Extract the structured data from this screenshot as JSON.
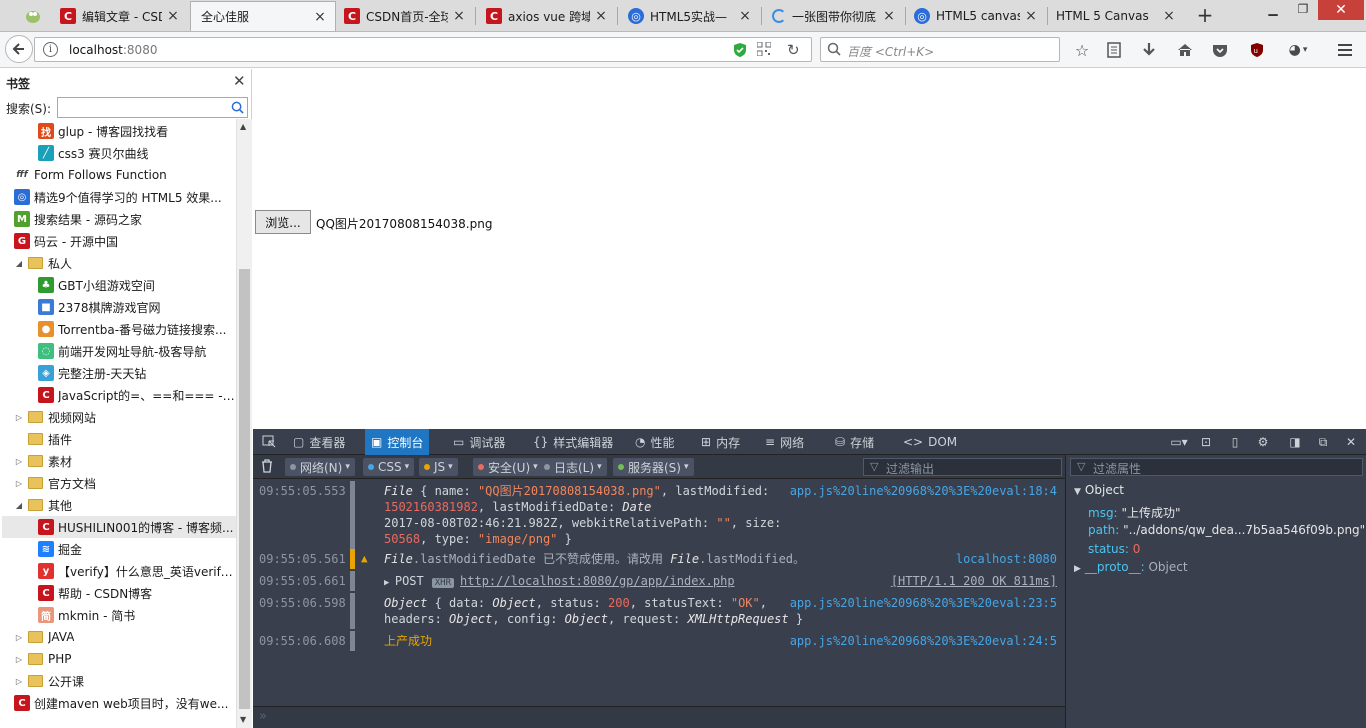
{
  "tabs": [
    {
      "label": "编辑文章 - CSD",
      "favicon": "csdn-icon"
    },
    {
      "label": "全心佳服",
      "favicon": "",
      "active": true
    },
    {
      "label": "CSDN首页-全球",
      "favicon": "csdn-icon"
    },
    {
      "label": "axios vue 跨域",
      "favicon": "csdn-icon"
    },
    {
      "label": "HTML5实战—",
      "favicon": "globe-icon"
    },
    {
      "label": "一张图带你彻底",
      "favicon": "loading-icon"
    },
    {
      "label": "HTML5 canvas",
      "favicon": "globe-icon"
    },
    {
      "label": "HTML 5 Canvas",
      "favicon": ""
    }
  ],
  "navbar": {
    "url_host": "localhost",
    "url_port": ":8080",
    "search_placeholder": "百度 <Ctrl+K>"
  },
  "sidebar": {
    "title": "书签",
    "search_label": "搜索(S):",
    "items": [
      {
        "label": "glup - 博客园找找看",
        "indent": 2,
        "type": "link",
        "icon": "find-icon",
        "color": "#e04a1a"
      },
      {
        "label": "css3 赛贝尔曲线",
        "indent": 2,
        "type": "link",
        "icon": "slash-icon",
        "color": "#1aa0b8"
      },
      {
        "label": "Form Follows Function",
        "indent": 1,
        "type": "link",
        "icon": "fff-icon",
        "color": "#444444"
      },
      {
        "label": "精选9个值得学习的 HTML5 效果...",
        "indent": 1,
        "type": "link",
        "icon": "globe-icon",
        "color": "#2a6dd8"
      },
      {
        "label": "搜索结果 - 源码之家",
        "indent": 1,
        "type": "link",
        "icon": "m-icon",
        "color": "#52a12e"
      },
      {
        "label": "码云 - 开源中国",
        "indent": 1,
        "type": "link",
        "icon": "gitee-icon",
        "color": "#c7151d"
      },
      {
        "label": "私人",
        "indent": 1,
        "type": "folder",
        "open": true
      },
      {
        "label": "GBT小组游戏空间",
        "indent": 2,
        "type": "link",
        "icon": "tree-icon",
        "color": "#2f9a2f"
      },
      {
        "label": "2378棋牌游戏官网",
        "indent": 2,
        "type": "link",
        "icon": "cube-icon",
        "color": "#3a7bd5"
      },
      {
        "label": "Torrentba-番号磁力链接搜索...",
        "indent": 2,
        "type": "link",
        "icon": "orb-icon",
        "color": "#e8912a"
      },
      {
        "label": "前端开发网址导航-极客导航",
        "indent": 2,
        "type": "link",
        "icon": "ring-icon",
        "color": "#3fbf7f"
      },
      {
        "label": "完整注册-天天钻",
        "indent": 2,
        "type": "link",
        "icon": "diamond-icon",
        "color": "#3aa0d8"
      },
      {
        "label": "JavaScript的=、==和=== - ...",
        "indent": 2,
        "type": "link",
        "icon": "csdn-icon",
        "color": "#c7151d"
      },
      {
        "label": "视频网站",
        "indent": 1,
        "type": "folder",
        "open": false
      },
      {
        "label": "插件",
        "indent": 1,
        "type": "folder",
        "open": null
      },
      {
        "label": "素材",
        "indent": 1,
        "type": "folder",
        "open": false
      },
      {
        "label": "官方文档",
        "indent": 1,
        "type": "folder",
        "open": false
      },
      {
        "label": "其他",
        "indent": 1,
        "type": "folder",
        "open": true
      },
      {
        "label": "HUSHILIN001的博客 - 博客频...",
        "indent": 2,
        "type": "link",
        "icon": "csdn-icon",
        "color": "#c7151d",
        "selected": true
      },
      {
        "label": "掘金",
        "indent": 2,
        "type": "link",
        "icon": "juejin-icon",
        "color": "#1e80ff"
      },
      {
        "label": "【verify】什么意思_英语verify...",
        "indent": 2,
        "type": "link",
        "icon": "youdao-icon",
        "color": "#e03030"
      },
      {
        "label": "帮助 - CSDN博客",
        "indent": 2,
        "type": "link",
        "icon": "csdn-icon",
        "color": "#c7151d"
      },
      {
        "label": "mkmin - 简书",
        "indent": 2,
        "type": "link",
        "icon": "jianshu-icon",
        "color": "#e9967a"
      },
      {
        "label": "JAVA",
        "indent": 1,
        "type": "folder",
        "open": false
      },
      {
        "label": "PHP",
        "indent": 1,
        "type": "folder",
        "open": false
      },
      {
        "label": "公开课",
        "indent": 1,
        "type": "folder",
        "open": false
      },
      {
        "label": "创建maven web项目时，没有we...",
        "indent": 1,
        "type": "link",
        "icon": "csdn-icon",
        "color": "#c7151d"
      }
    ]
  },
  "page": {
    "browse_button": "浏览...",
    "file_name": "QQ图片20170808154038.png"
  },
  "devtools": {
    "tabs": [
      {
        "label": "查看器",
        "icon": "inspector-icon"
      },
      {
        "label": "控制台",
        "icon": "console-icon",
        "active": true
      },
      {
        "label": "调试器",
        "icon": "debugger-icon"
      },
      {
        "label": "样式编辑器",
        "icon": "style-editor-icon"
      },
      {
        "label": "性能",
        "icon": "performance-icon"
      },
      {
        "label": "内存",
        "icon": "memory-icon"
      },
      {
        "label": "网络",
        "icon": "network-icon"
      },
      {
        "label": "存储",
        "icon": "storage-icon"
      },
      {
        "label": "DOM",
        "icon": "dom-icon"
      }
    ],
    "filters": [
      {
        "label": "网络(N)",
        "color": "#8c96a3"
      },
      {
        "label": "CSS",
        "color": "#46a6e6"
      },
      {
        "label": "JS",
        "color": "#e8a500"
      },
      {
        "label": "安全(U)",
        "color": "#ec6a5e"
      },
      {
        "label": "日志(L)",
        "color": "#8c96a3"
      },
      {
        "label": "服务器(S)",
        "color": "#70bf53"
      }
    ],
    "filter_output_placeholder": "过滤输出",
    "filter_props_placeholder": "过滤属性",
    "console": [
      {
        "time": "09:55:05.553",
        "type": "log",
        "lines": [
          "File { name: \"QQ图片20170808154038.png\", lastModified:",
          "1502160381982, lastModifiedDate: Date",
          "2017-08-08T02:46:21.982Z, webkitRelativePath: \"\", size:",
          "50568, type: \"image/png\" }"
        ],
        "source": "app.js%20line%20968%20%3E%20eval:18:4"
      },
      {
        "time": "09:55:05.561",
        "type": "warn",
        "lines": [
          "File.lastModifiedDate 已不赞成使用。请改用 File.lastModified。"
        ],
        "source": "localhost:8080"
      },
      {
        "time": "09:55:05.661",
        "type": "net",
        "method": "POST",
        "badge": "XHR",
        "url": "http://localhost:8080/gp/app/index.php",
        "status": "[HTTP/1.1 200 OK 811ms]"
      },
      {
        "time": "09:55:06.598",
        "type": "log",
        "lines": [
          "Object { data: Object, status: 200, statusText: \"OK\",",
          "headers: Object, config: Object, request: XMLHttpRequest }"
        ],
        "source": "app.js%20line%20968%20%3E%20eval:23:5"
      },
      {
        "time": "09:55:06.608",
        "type": "log",
        "lines": [
          "上产成功"
        ],
        "source": "app.js%20line%20968%20%3E%20eval:24:5"
      }
    ],
    "inspector": {
      "root": "Object",
      "props": [
        {
          "key": "msg:",
          "value": "\"上传成功\""
        },
        {
          "key": "path:",
          "value": "\"../addons/qw_dea...7b5aa546f09b.png\""
        },
        {
          "key": "status:",
          "value": "0"
        },
        {
          "key": "__proto__:",
          "value": "Object"
        }
      ]
    }
  }
}
